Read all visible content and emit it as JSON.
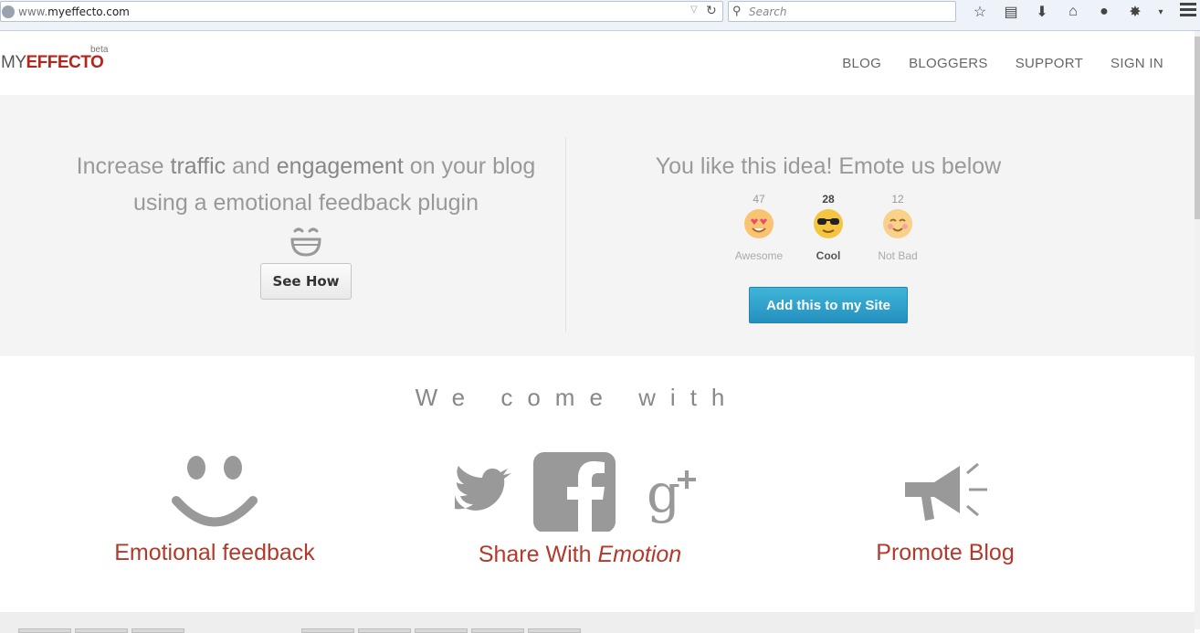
{
  "browser": {
    "url_prefix": "www.",
    "url_host": "myeffecto.com",
    "search_placeholder": "Search"
  },
  "site": {
    "logo_my": "MY",
    "logo_effecto": "EFFECTO",
    "beta": "beta",
    "nav": [
      "BLOG",
      "BLOGGERS",
      "SUPPORT",
      "SIGN IN"
    ]
  },
  "hero": {
    "left_line1_pre": "Increase ",
    "left_bold1": "traffic",
    "left_mid": " and ",
    "left_bold2": "engagement",
    "left_line1_post": " on your blog",
    "left_line2": "using a emotional feedback plugin",
    "see_how": "See How",
    "right_title": "You like this idea! Emote us below",
    "emotes": [
      {
        "count": "47",
        "label": "Awesome",
        "icon": "heart-eyes-emoji-icon",
        "active": false
      },
      {
        "count": "28",
        "label": "Cool",
        "icon": "sunglasses-emoji-icon",
        "active": true
      },
      {
        "count": "12",
        "label": "Not Bad",
        "icon": "blush-emoji-icon",
        "active": false
      }
    ],
    "add_button": "Add this to my Site"
  },
  "features": {
    "title": "We come with",
    "items": [
      {
        "label": "Emotional feedback",
        "icon": "smiley-icon"
      },
      {
        "label_plain": "Share With ",
        "label_em": "Emotion",
        "icon": "social-icons"
      },
      {
        "label": "Promote Blog",
        "icon": "megaphone-icon"
      }
    ]
  },
  "colors": {
    "brand_red": "#b3261e",
    "button_blue": "#2a9bc9",
    "hero_bg": "#f4f4f4"
  }
}
